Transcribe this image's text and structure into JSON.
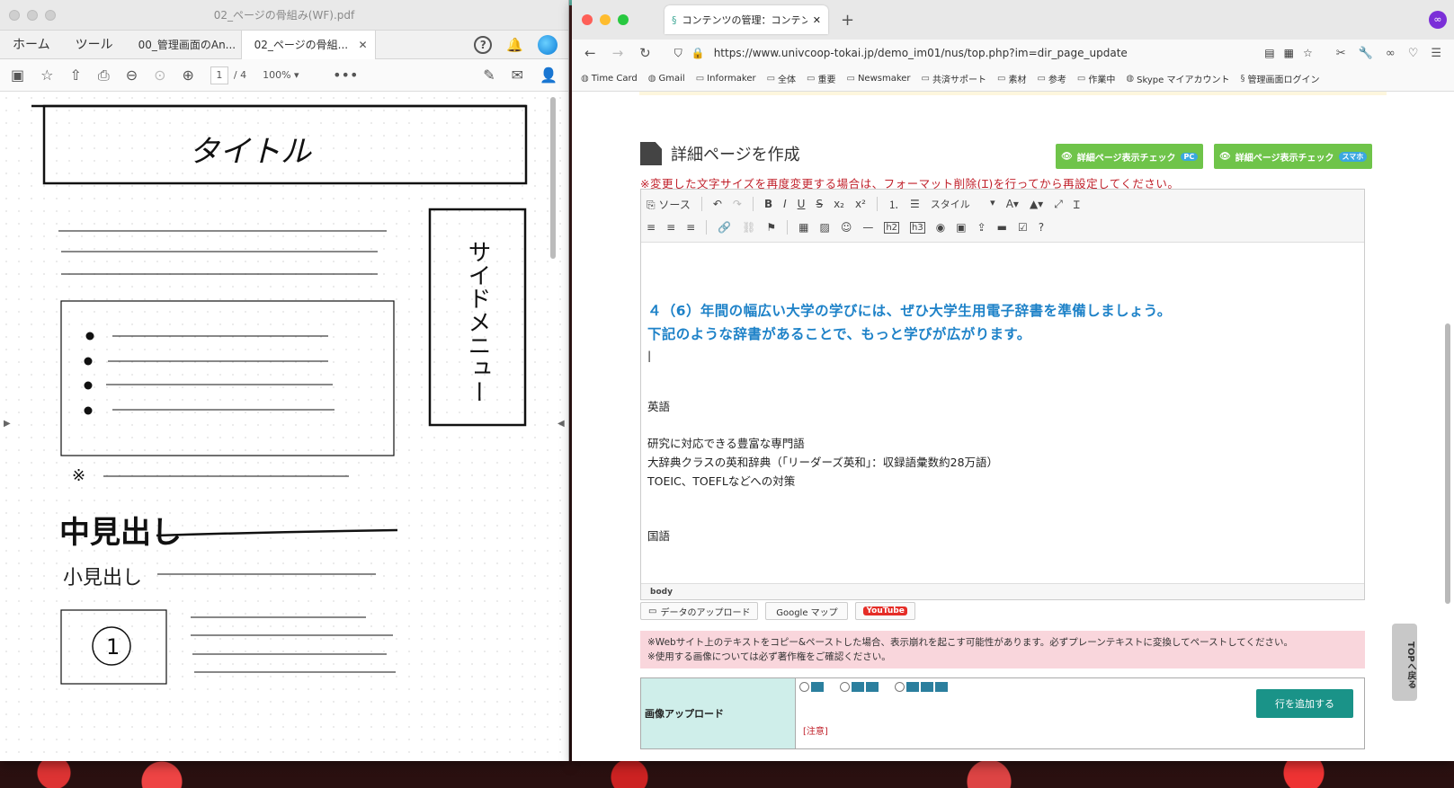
{
  "pdf": {
    "title": "02_ページの骨組み(WF).pdf",
    "tabs": [
      "ホーム",
      "ツール",
      "00_管理画面のAn...",
      "02_ページの骨組..."
    ],
    "toolbar": {
      "page_current": "1",
      "page_total": "/ 4",
      "zoom": "100%"
    },
    "sketch": {
      "title": "タイトル",
      "side_menu": "サイドメニュー",
      "note": "※",
      "mid_heading": "中見出し",
      "small_heading": "小見出し",
      "circled": "1"
    }
  },
  "browser": {
    "tab_title": "コンテンツの管理：コンテンツ作成",
    "url": "https://www.univcoop-tokai.jp/demo_im01/nus/top.php?im=dir_page_update",
    "bookmarks": [
      "Time Card",
      "Gmail",
      "Informaker",
      "全体",
      "重要",
      "Newsmaker",
      "共済サポート",
      "素材",
      "参考",
      "作業中",
      "Skype マイアカウント",
      "管理画面ログイン"
    ]
  },
  "page": {
    "section_title": "詳細ページを作成",
    "check_pc": "詳細ページ表示チェック",
    "check_pc_badge": "PC",
    "check_sp": "詳細ページ表示チェック",
    "check_sp_badge": "スマホ",
    "warning": "※変更した文字サイズを再度変更する場合は、フォーマット削除(Ɪ)を行ってから再設定してください。",
    "editor_toolbar": {
      "source": "ソース",
      "style": "スタイル"
    },
    "editor": {
      "blue_line1": "４（6）年間の幅広い大学の学びには、ぜひ大学生用電子辞書を準備しましょう。",
      "blue_line2": "下記のような辞書があることで、もっと学びが広がります。",
      "eng_head": "英語",
      "eng_1": "研究に対応できる豊富な専門語",
      "eng_2": "大辞典クラスの英和辞典（「リーダーズ英和」：収録語彙数約28万語）",
      "eng_3": "TOEIC、TOEFLなどへの対策",
      "jp_head": "国語",
      "path": "body"
    },
    "util": {
      "upload": "データのアップロード",
      "map": "Google マップ",
      "youtube": "YouTube"
    },
    "note_1": "※Webサイト上のテキストをコピー&ペーストした場合、表示崩れを起こす可能性があります。必ずプレーンテキストに変換してペーストしてください。",
    "note_2": "※使用する画像については必ず著作権をご確認ください。",
    "top_button": "TOPへ戻る",
    "image_upload_label": "画像アップロード",
    "add_row": "行を追加する",
    "caution": "[注意]"
  },
  "colors": {
    "accent_teal": "#1a9388",
    "blue_text": "#1e82c8",
    "warn_red": "#c0202a",
    "check_green": "#6fc44a"
  }
}
